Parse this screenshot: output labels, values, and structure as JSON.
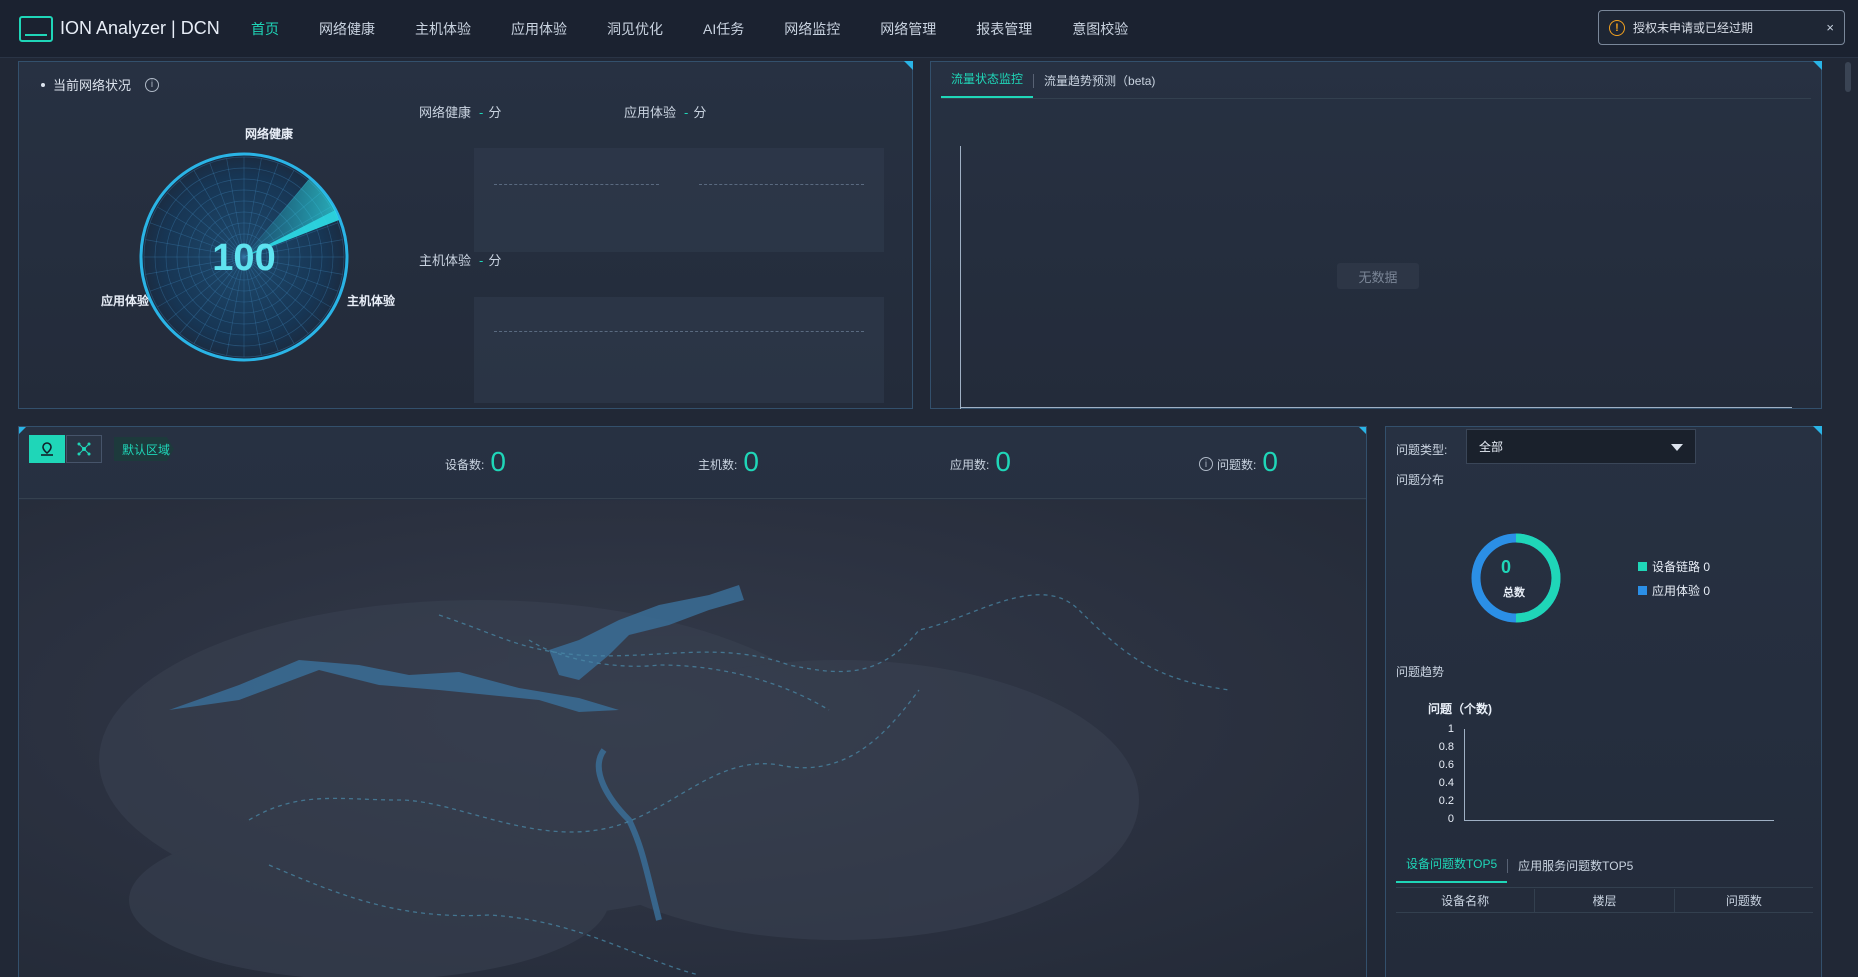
{
  "app": {
    "title": "ION Analyzer | DCN"
  },
  "nav": {
    "items": [
      {
        "label": "首页",
        "active": true
      },
      {
        "label": "网络健康"
      },
      {
        "label": "主机体验"
      },
      {
        "label": "应用体验"
      },
      {
        "label": "洞见优化"
      },
      {
        "label": "AI任务"
      },
      {
        "label": "网络监控"
      },
      {
        "label": "网络管理"
      },
      {
        "label": "报表管理"
      },
      {
        "label": "意图校验"
      }
    ]
  },
  "alert": {
    "icon": "warning-icon",
    "text": "授权未申请或已经过期",
    "close": "×"
  },
  "status": {
    "title": "当前网络状况",
    "info_icon": "i",
    "radar": {
      "score": "100",
      "top": "网络健康",
      "left": "应用体验",
      "right": "主机体验"
    },
    "metrics": {
      "network": {
        "label": "网络健康",
        "value": "-",
        "unit": "分"
      },
      "app": {
        "label": "应用体验",
        "value": "-",
        "unit": "分"
      },
      "host": {
        "label": "主机体验",
        "value": "-",
        "unit": "分"
      }
    }
  },
  "traffic": {
    "tabs": [
      {
        "label": "流量状态监控",
        "active": true
      },
      {
        "label": "流量趋势预测（beta)"
      }
    ],
    "no_data": "无数据"
  },
  "map": {
    "tool_map_icon": "map-icon",
    "tool_topo_icon": "topology-icon",
    "region": "默认区域",
    "stats": {
      "devices": {
        "label": "设备数:",
        "value": "0"
      },
      "hosts": {
        "label": "主机数:",
        "value": "0"
      },
      "apps": {
        "label": "应用数:",
        "value": "0"
      },
      "issues": {
        "label": "问题数:",
        "value": "0",
        "icon": "i"
      }
    }
  },
  "issues": {
    "type_label": "问题类型:",
    "type_value": "全部",
    "distribution_title": "问题分布",
    "total_value": "0",
    "total_label": "总数",
    "legend": [
      {
        "label": "设备链路 0",
        "color": "#1fd6b8"
      },
      {
        "label": "应用体验 0",
        "color": "#2b8fe6"
      }
    ],
    "trend_title": "问题趋势",
    "top5_tabs": [
      {
        "label": "设备问题数TOP5",
        "active": true
      },
      {
        "label": "应用服务问题数TOP5"
      }
    ],
    "table_headers": [
      "设备名称",
      "楼层",
      "问题数"
    ]
  },
  "chart_data": {
    "type": "line",
    "ylabel": "问题（个数)",
    "ylim": [
      0,
      1
    ],
    "yticks": [
      "1",
      "0.8",
      "0.6",
      "0.4",
      "0.2",
      "0"
    ],
    "x": [],
    "series": []
  },
  "colors": {
    "accent": "#1fd6b8",
    "blue": "#2b8fe6",
    "warning": "#f0a020"
  }
}
